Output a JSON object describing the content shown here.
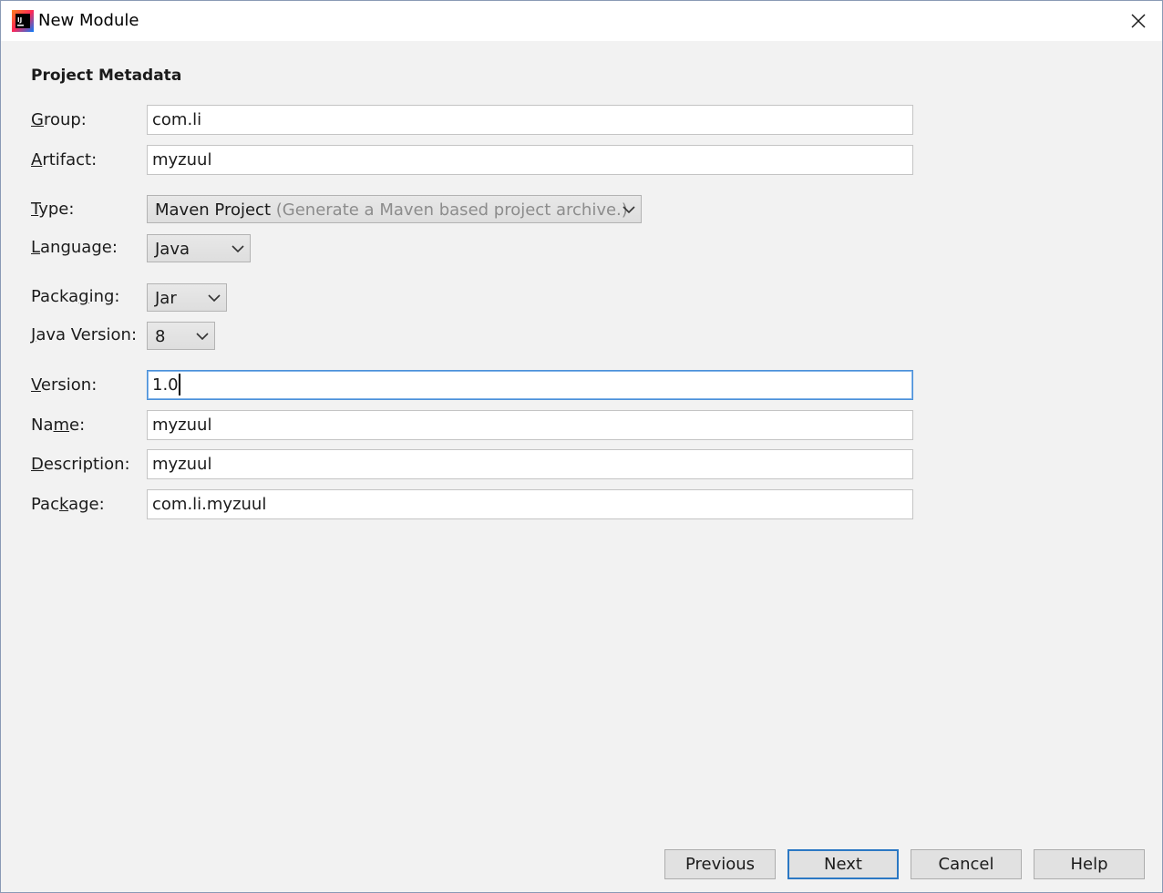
{
  "window": {
    "title": "New Module",
    "icon_text": "IJ"
  },
  "section": {
    "title": "Project Metadata"
  },
  "fields": {
    "group": {
      "label_pre": "",
      "label_key": "G",
      "label_post": "roup:",
      "value": "com.li"
    },
    "artifact": {
      "label_pre": "",
      "label_key": "A",
      "label_post": "rtifact:",
      "value": "myzuul"
    },
    "type": {
      "label_pre": "",
      "label_key": "T",
      "label_post": "ype:",
      "value": "Maven Project",
      "hint": "(Generate a Maven based project archive.)"
    },
    "language": {
      "label_pre": "",
      "label_key": "L",
      "label_post": "anguage:",
      "value": "Java"
    },
    "packaging": {
      "label_pre": "Packa",
      "label_key": "g",
      "label_post": "ing:",
      "value": "Jar"
    },
    "java_version": {
      "label_pre": "",
      "label_key": "J",
      "label_post": "ava Version:",
      "value": "8"
    },
    "version": {
      "label_pre": "",
      "label_key": "V",
      "label_post": "ersion:",
      "value": "1.0"
    },
    "name": {
      "label_pre": "Na",
      "label_key": "m",
      "label_post": "e:",
      "value": "myzuul"
    },
    "description": {
      "label_pre": "",
      "label_key": "D",
      "label_post": "escription:",
      "value": "myzuul"
    },
    "package": {
      "label_pre": "Pac",
      "label_key": "k",
      "label_post": "age:",
      "value": "com.li.myzuul"
    }
  },
  "buttons": {
    "previous": "Previous",
    "next": "Next",
    "cancel": "Cancel",
    "help": "Help"
  },
  "colors": {
    "focus_border": "#4a90d9",
    "default_button_border": "#2b78c4",
    "window_bg": "#f2f2f2"
  }
}
